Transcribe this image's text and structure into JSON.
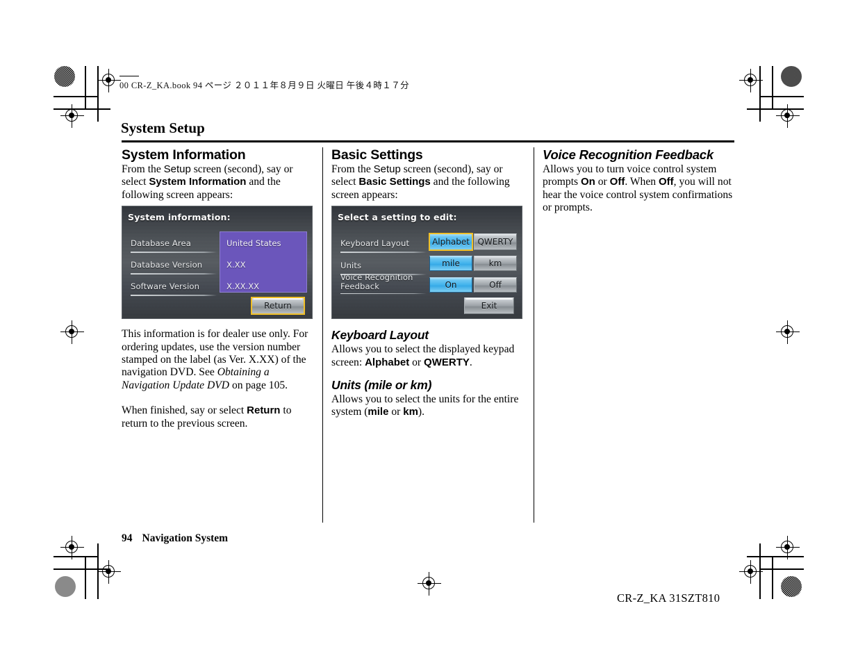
{
  "print_header": "00 CR-Z_KA.book   94 ページ   ２０１１年８月９日   火曜日   午後４時１７分",
  "page_title": "System Setup",
  "columns": {
    "left": {
      "heading": "System Information",
      "intro_1": "From the ",
      "intro_setup": "Setup",
      "intro_2": " screen (second), say or select ",
      "intro_bold": "System Information",
      "intro_3": " and the following screen appears:",
      "para_1": "This information is for dealer use only. For ordering updates, use the version number stamped on the label (as Ver. X.XX) of the navigation DVD. See ",
      "para_1_italic": "Obtaining a Navigation Update DVD",
      "para_1_end": " on page 105.",
      "para_2_start": "When finished, say or select ",
      "para_2_bold": "Return",
      "para_2_end": " to return to the previous screen."
    },
    "middle": {
      "heading": "Basic Settings",
      "intro_1": "From the ",
      "intro_setup": "Setup",
      "intro_2": " screen (second), say or select ",
      "intro_bold": "Basic Settings",
      "intro_3": " and the following screen appears:",
      "sub1_heading": "Keyboard Layout",
      "sub1_text_1": "Allows you to select the displayed keypad screen: ",
      "sub1_bold_1": "Alphabet",
      "sub1_text_2": " or ",
      "sub1_bold_2": "QWERTY",
      "sub1_text_3": ".",
      "sub2_heading": "Units (mile or km)",
      "sub2_text_1": "Allows you to select the units for the entire system (",
      "sub2_bold_1": "mile",
      "sub2_text_2": " or ",
      "sub2_bold_2": "km",
      "sub2_text_3": ")."
    },
    "right": {
      "heading": "Voice Recognition Feedback",
      "text_1": "Allows you to turn voice control system prompts ",
      "bold_1": "On",
      "text_2": " or ",
      "bold_2": "Off",
      "text_3": ". When ",
      "bold_3": "Off",
      "text_4": ", you will not hear the voice control system confirmations or prompts."
    }
  },
  "nav_screens": {
    "system_information": {
      "title": "System information:",
      "rows": [
        {
          "label": "Database Area",
          "value": "United States"
        },
        {
          "label": "Database Version",
          "value": "X.XX"
        },
        {
          "label": "Software Version",
          "value": "X.XX.XX"
        }
      ],
      "button": "Return",
      "panel_color": "#6b56bb",
      "focus_color": "#f0bf28"
    },
    "basic_settings": {
      "title": "Select a setting to edit:",
      "rows": [
        {
          "label": "Keyboard Layout",
          "options": [
            {
              "text": "Alphabet",
              "selected": true,
              "focused": true
            },
            {
              "text": "QWERTY",
              "selected": false,
              "focused": false
            }
          ]
        },
        {
          "label": "Units",
          "options": [
            {
              "text": "mile",
              "selected": true,
              "focused": false
            },
            {
              "text": "km",
              "selected": false,
              "focused": false
            }
          ]
        },
        {
          "label_line1": "Voice Recognition",
          "label_line2": "Feedback",
          "options": [
            {
              "text": "On",
              "selected": true,
              "focused": false
            },
            {
              "text": "Off",
              "selected": false,
              "focused": false
            }
          ]
        }
      ],
      "button": "Exit",
      "selected_color": "#3fb2ec"
    }
  },
  "footer": {
    "page_number": "94",
    "section": "Navigation System",
    "doc_code": "CR-Z_KA  31SZT810"
  }
}
